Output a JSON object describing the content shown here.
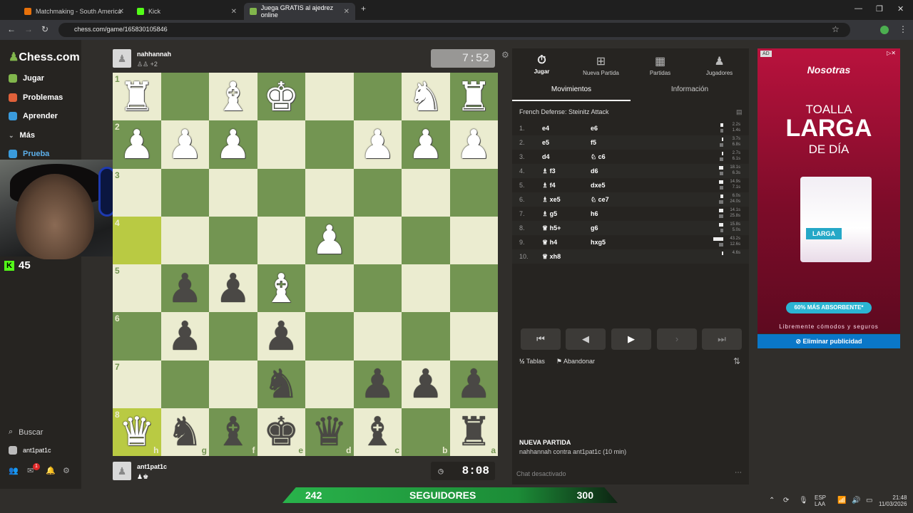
{
  "browser": {
    "tabs": [
      {
        "label": "Matchmaking - South America",
        "color": "#e8710a",
        "active": false
      },
      {
        "label": "Kick",
        "color": "#53fc18",
        "active": false
      },
      {
        "label": "Juega GRATIS al ajedrez online",
        "color": "#81b64c",
        "active": true
      }
    ],
    "url": "chess.com/game/165830105846"
  },
  "sidebar": {
    "logo": "Chess.com",
    "items": [
      {
        "label": "Jugar",
        "color": "#81b64c"
      },
      {
        "label": "Problemas",
        "color": "#e0613a"
      },
      {
        "label": "Aprender",
        "color": "#3a9bdc"
      },
      {
        "label": "Más",
        "color": "#999999"
      },
      {
        "label": "Prueba",
        "color": "#3a9bdc"
      }
    ],
    "search": "Buscar",
    "username": "ant1pat1c",
    "notification_count": "1"
  },
  "stream": {
    "viewers": "45"
  },
  "top_player": {
    "name": "nahhannah",
    "sub": "+2",
    "clock": "7:52"
  },
  "bottom_player": {
    "name": "ant1pat1c",
    "clock": "8:08"
  },
  "board": {
    "orientation": "black",
    "rows": [
      [
        "wR",
        "",
        "wB",
        "wK",
        "",
        "",
        "wN",
        "wR"
      ],
      [
        "wP",
        "wP",
        "wP",
        "",
        "",
        "wP",
        "wP",
        "wP"
      ],
      [
        "",
        "",
        "",
        "",
        "",
        "",
        "",
        ""
      ],
      [
        "",
        "",
        "",
        "",
        "wP",
        "",
        "",
        ""
      ],
      [
        "",
        "bP",
        "bP",
        "wB",
        "",
        "",
        "",
        ""
      ],
      [
        "",
        "bP",
        "",
        "bP",
        "",
        "",
        "",
        ""
      ],
      [
        "",
        "",
        "",
        "bN",
        "",
        "bP",
        "bP",
        "bP"
      ],
      [
        "wQ",
        "bN",
        "bB",
        "bK",
        "bQ",
        "bB",
        "",
        "bR"
      ]
    ],
    "rank_labels": [
      "1",
      "2",
      "3",
      "4",
      "5",
      "6",
      "7",
      "8"
    ],
    "file_labels": [
      "h",
      "g",
      "f",
      "e",
      "d",
      "c",
      "b",
      "a"
    ],
    "highlights": [
      [
        3,
        0
      ],
      [
        7,
        0
      ]
    ]
  },
  "panel": {
    "tabs": [
      {
        "label": "Jugar",
        "icon": "⏱"
      },
      {
        "label": "Nueva Partida",
        "icon": "⊞"
      },
      {
        "label": "Partidas",
        "icon": "▦"
      },
      {
        "label": "Jugadores",
        "icon": "👤"
      }
    ],
    "subtabs": [
      "Movimientos",
      "Información"
    ],
    "opening": "French Defense: Steinitz Attack",
    "moves": [
      {
        "n": "1.",
        "w": "e4",
        "b": "e6",
        "t": [
          "2.2s",
          "1.4s"
        ]
      },
      {
        "n": "2.",
        "w": "e5",
        "b": "f5",
        "t": [
          "3.7s",
          "6.8s"
        ]
      },
      {
        "n": "3.",
        "w": "d4",
        "b": "♘ c6",
        "t": [
          "2.7s",
          "6.1s"
        ]
      },
      {
        "n": "4.",
        "w": "♗ f3",
        "b": "d6",
        "t": [
          "18.1s",
          "6.3s"
        ]
      },
      {
        "n": "5.",
        "w": "♗ f4",
        "b": "dxe5",
        "t": [
          "14.9s",
          "7.1s"
        ]
      },
      {
        "n": "6.",
        "w": "♗ xe5",
        "b": "♘ ce7",
        "t": [
          "6.0s",
          "24.0s"
        ]
      },
      {
        "n": "7.",
        "w": "♗ g5",
        "b": "h6",
        "t": [
          "14.1s",
          "25.8s"
        ]
      },
      {
        "n": "8.",
        "w": "♕ h5+",
        "b": "g6",
        "t": [
          "15.8s",
          "5.0s"
        ]
      },
      {
        "n": "9.",
        "w": "♕ h4",
        "b": "hxg5",
        "t": [
          "43.2s",
          "12.6s"
        ]
      },
      {
        "n": "10.",
        "w": "♕ xh8",
        "b": "",
        "t": [
          "4.6s",
          ""
        ]
      }
    ],
    "actions": {
      "draw": "Tablas",
      "resign": "Abandonar"
    },
    "new_game_title": "NUEVA PARTIDA",
    "match_info": "nahhannah contra ant1pat1c (10 min)",
    "chat_status": "Chat desactivado"
  },
  "ad": {
    "tag": "AD",
    "brand": "Nosotras",
    "line1": "TOALLA",
    "line2": "LARGA",
    "line3": "DE DÍA",
    "pack_label": "LARGA",
    "badge": "60% MÁS ABSORBENTE*",
    "tagline": "Libremente cómodos y seguros",
    "remove": "Eliminar publicidad"
  },
  "overlay": {
    "count": "242",
    "label": "SEGUIDORES",
    "goal": "300"
  },
  "tray": {
    "lang": "ESP",
    "region": "LAA",
    "time": "21:48",
    "date": "11/03/2026"
  }
}
